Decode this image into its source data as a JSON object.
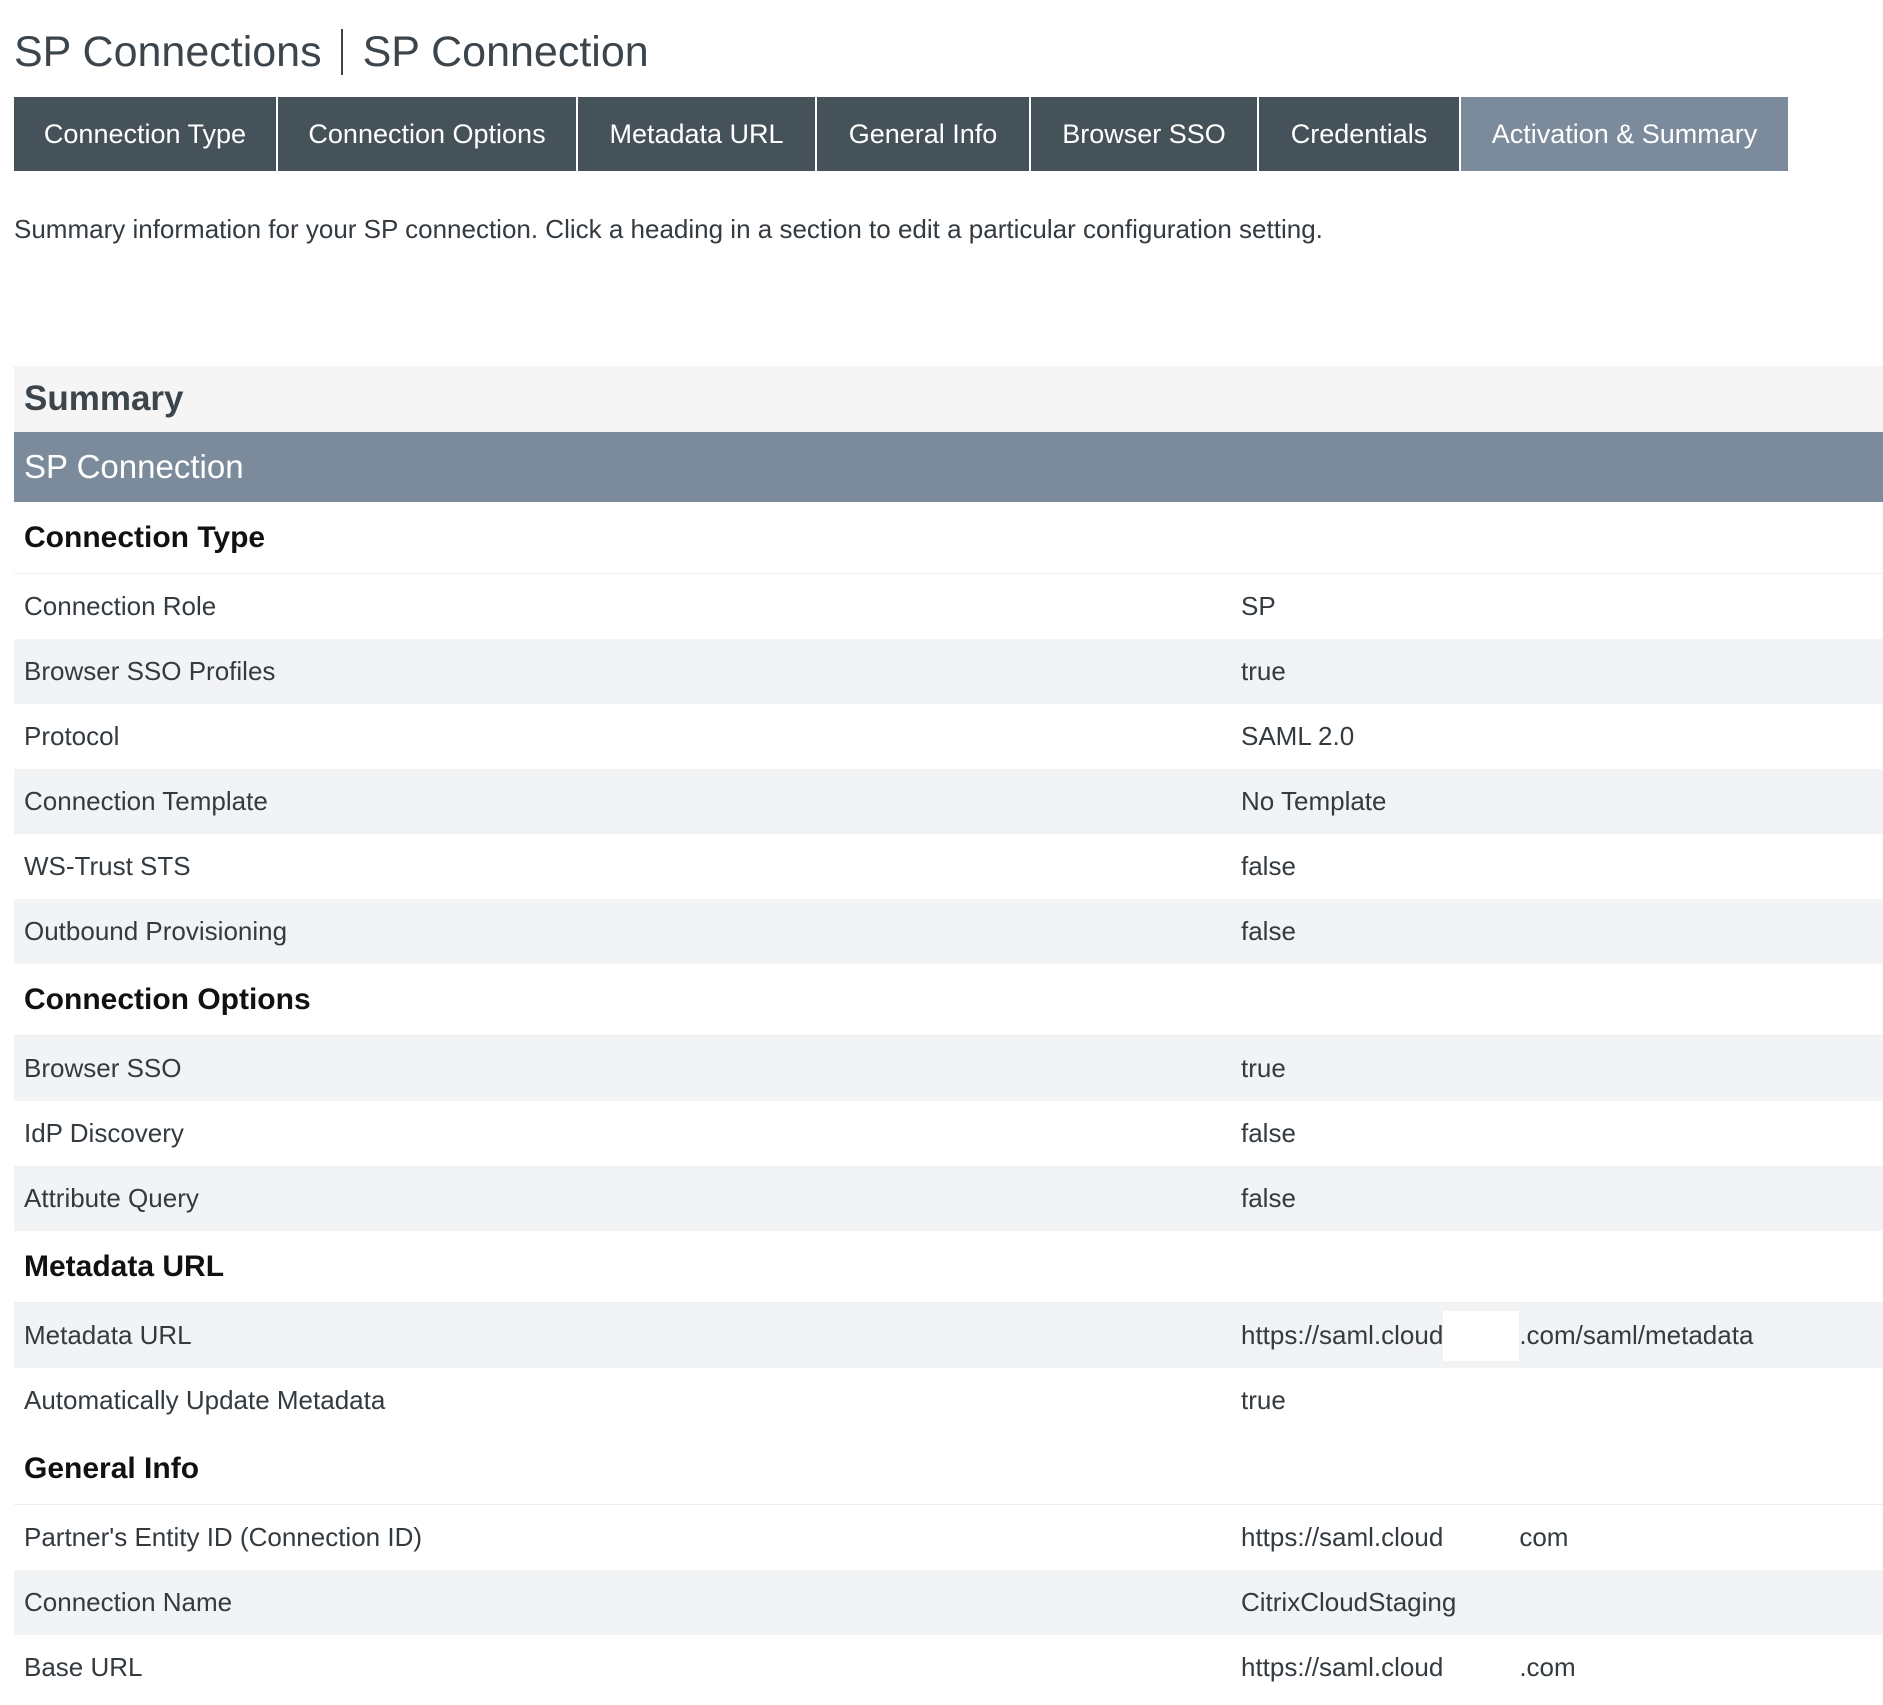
{
  "breadcrumb": {
    "parent": "SP Connections",
    "current": "SP Connection"
  },
  "tabs": [
    {
      "label": "Connection Type",
      "active": false
    },
    {
      "label": "Connection Options",
      "active": false
    },
    {
      "label": "Metadata URL",
      "active": false
    },
    {
      "label": "General Info",
      "active": false
    },
    {
      "label": "Browser SSO",
      "active": false
    },
    {
      "label": "Credentials",
      "active": false
    },
    {
      "label": "Activation & Summary",
      "active": true
    }
  ],
  "intro": "Summary information for your SP connection. Click a heading in a section to edit a particular configuration setting.",
  "summary": {
    "title": "Summary",
    "band": "SP Connection",
    "sections": {
      "connection_type": {
        "title": "Connection Type",
        "rows": [
          {
            "label": "Connection Role",
            "value": "SP"
          },
          {
            "label": "Browser SSO Profiles",
            "value": "true"
          },
          {
            "label": "Protocol",
            "value": "SAML 2.0"
          },
          {
            "label": "Connection Template",
            "value": "No Template"
          },
          {
            "label": "WS-Trust STS",
            "value": "false"
          },
          {
            "label": "Outbound Provisioning",
            "value": "false"
          }
        ]
      },
      "connection_options": {
        "title": "Connection Options",
        "rows": [
          {
            "label": "Browser SSO",
            "value": "true"
          },
          {
            "label": "IdP Discovery",
            "value": "false"
          },
          {
            "label": "Attribute Query",
            "value": "false"
          }
        ]
      },
      "metadata_url": {
        "title": "Metadata URL",
        "rows": [
          {
            "label": "Metadata URL",
            "value_prefix": "https://saml.cloud",
            "value_suffix": ".com/saml/metadata"
          },
          {
            "label": "Automatically Update Metadata",
            "value": "true"
          }
        ]
      },
      "general_info": {
        "title": "General Info",
        "rows": [
          {
            "label": "Partner's Entity ID (Connection ID)",
            "value_prefix": "https://saml.cloud",
            "value_suffix": "com"
          },
          {
            "label": "Connection Name",
            "value": "CitrixCloudStaging"
          },
          {
            "label": "Base URL",
            "value_prefix": "https://saml.cloud",
            "value_suffix": ".com"
          }
        ]
      }
    }
  }
}
